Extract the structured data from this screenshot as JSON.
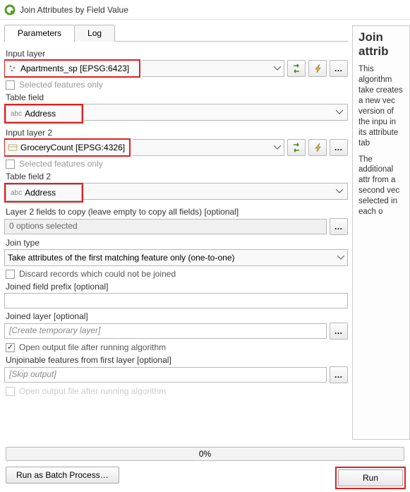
{
  "title": "Join Attributes by Field Value",
  "tabs": {
    "parameters": "Parameters",
    "log": "Log"
  },
  "labels": {
    "input_layer": "Input layer",
    "selected_only": "Selected features only",
    "table_field": "Table field",
    "input_layer2": "Input layer 2",
    "selected_only2": "Selected features only",
    "table_field2": "Table field 2",
    "fields_to_copy": "Layer 2 fields to copy (leave empty to copy all fields) [optional]",
    "join_type": "Join type",
    "discard": "Discard records which could not be joined",
    "prefix": "Joined field prefix [optional]",
    "joined_layer": "Joined layer [optional]",
    "open_output": "Open output file after running algorithm",
    "unjoinable": "Unjoinable features from first layer [optional]",
    "open_output2": "Open output file after running algorithm"
  },
  "values": {
    "input_layer": "Apartments_sp [EPSG:6423]",
    "table_field": "Address",
    "input_layer2": "GroceryCount [EPSG:4326]",
    "table_field2": "Address",
    "fields_to_copy": "0 options selected",
    "join_type": "Take attributes of the first matching feature only (one-to-one)",
    "prefix": "",
    "joined_layer_placeholder": "[Create temporary layer]",
    "unjoinable_placeholder": "[Skip output]"
  },
  "progress": "0%",
  "buttons": {
    "batch": "Run as Batch Process…",
    "run": "Run"
  },
  "help": {
    "title": "Join attrib",
    "p1": "This algorithm take creates a new vec version of the inpu in its attribute tab",
    "p2": "The additional attr from a second vec selected in each o"
  }
}
